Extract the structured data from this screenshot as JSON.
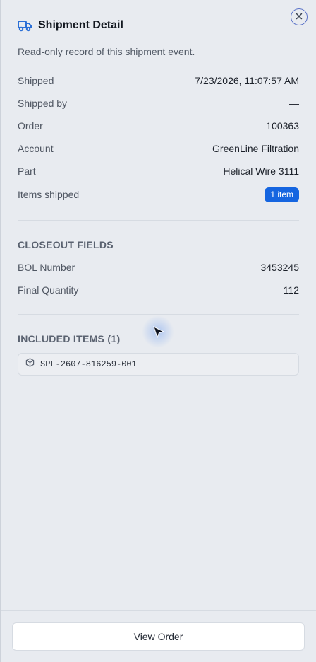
{
  "header": {
    "title": "Shipment Detail",
    "subtitle": "Read-only record of this shipment event.",
    "icon": "truck-icon",
    "close_icon": "close-icon"
  },
  "details": [
    {
      "label": "Shipped",
      "value": "7/23/2026, 11:07:57 AM"
    },
    {
      "label": "Shipped by",
      "value": "—"
    },
    {
      "label": "Order",
      "value": "100363"
    },
    {
      "label": "Account",
      "value": "GreenLine Filtration"
    },
    {
      "label": "Part",
      "value": "Helical Wire 3111"
    }
  ],
  "items_shipped": {
    "label": "Items shipped",
    "badge": "1 item"
  },
  "closeout": {
    "title": "CLOSEOUT FIELDS",
    "fields": [
      {
        "label": "BOL Number",
        "value": "3453245"
      },
      {
        "label": "Final Quantity",
        "value": "112"
      }
    ]
  },
  "included": {
    "title": "INCLUDED ITEMS (1)",
    "items": [
      {
        "code": "SPL-2607-816259-001",
        "icon": "package-icon"
      }
    ]
  },
  "footer": {
    "view_order_label": "View Order"
  },
  "colors": {
    "accent": "#1565e0",
    "background": "#e8ebf0",
    "close_ring": "#5b73c8"
  }
}
